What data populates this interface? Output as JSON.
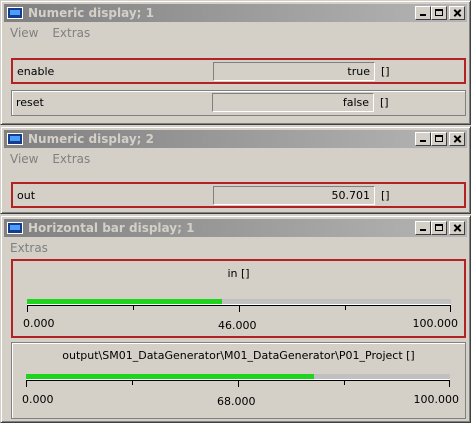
{
  "windows": [
    {
      "title": "Numeric display; 1",
      "menu": [
        "View",
        "Extras"
      ],
      "rows": [
        {
          "label": "enable",
          "value": "true",
          "unit": "[]"
        },
        {
          "label": "reset",
          "value": "false",
          "unit": "[]"
        }
      ]
    },
    {
      "title": "Numeric display; 2",
      "menu": [
        "View",
        "Extras"
      ],
      "rows": [
        {
          "label": "out",
          "value": "50.701",
          "unit": "[]"
        }
      ]
    },
    {
      "title": "Horizontal bar display; 1",
      "menu": [
        "Extras"
      ],
      "bars": [
        {
          "caption": "in []",
          "min_label": "0.000",
          "mid_label": "46.000",
          "max_label": "100.000",
          "min": 0,
          "max": 100,
          "value": 46
        },
        {
          "caption": "output\\SM01_DataGenerator\\M01_DataGenerator\\P01_Project []",
          "min_label": "0.000",
          "mid_label": "68.000",
          "max_label": "100.000",
          "min": 0,
          "max": 100,
          "value": 68
        }
      ]
    }
  ],
  "colors": {
    "bar_fill": "#1ed41e",
    "selected_border": "#b22222",
    "inactive_title": "#808080"
  }
}
